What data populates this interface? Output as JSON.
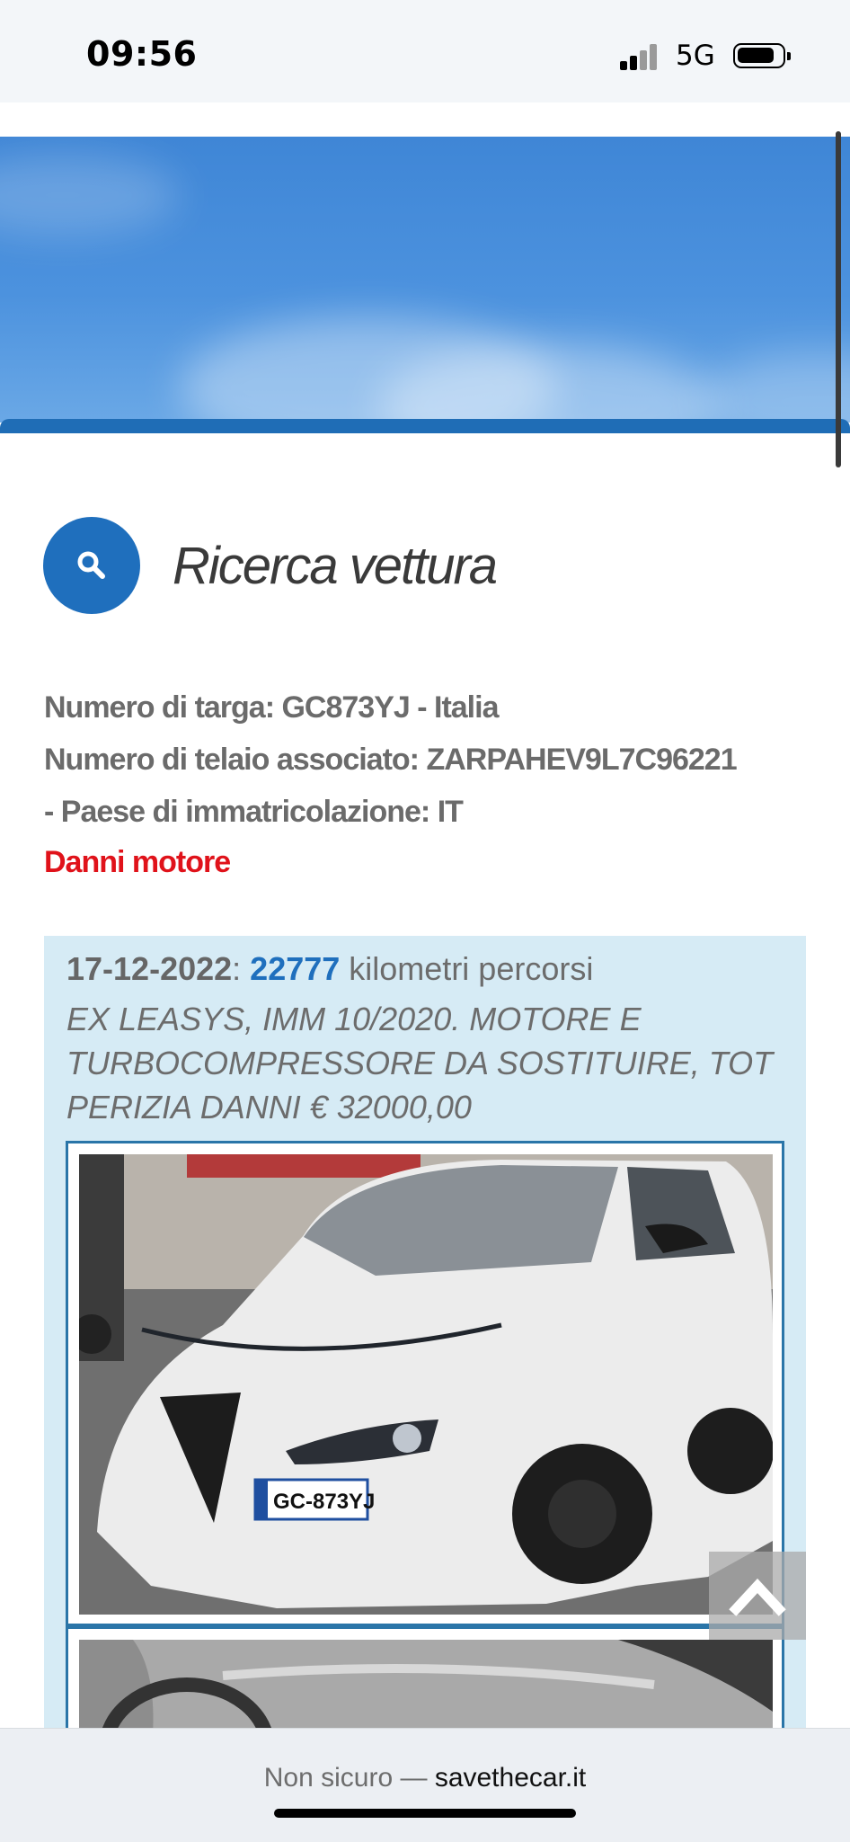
{
  "status": {
    "time": "09:56",
    "network": "5G"
  },
  "search": {
    "title": "Ricerca vettura"
  },
  "vehicle": {
    "plate_line": "Numero di targa: GC873YJ - Italia",
    "vin_line": "Numero di telaio associato: ZARPAHEV9L7C96221",
    "country_line": "- Paese di immatricolazione: IT",
    "damage_label": "Danni motore"
  },
  "entry": {
    "date": "17-12-2022",
    "separator": ": ",
    "km": "22777",
    "km_suffix": " kilometri percorsi",
    "description": "EX LEASYS, IMM 10/2020. MOTORE E TURBOCOMPRESSORE DA SOSTITUIRE, TOT PERIZIA DANNI € 32000,00"
  },
  "photo": {
    "plate_text": "GC-873YJ"
  },
  "url_bar": {
    "security": "Non sicuro — ",
    "host": "savethecar.it"
  },
  "colors": {
    "accent": "#1f6fbd",
    "damage": "#e0121a",
    "entry_bg": "#d6ebf5"
  }
}
